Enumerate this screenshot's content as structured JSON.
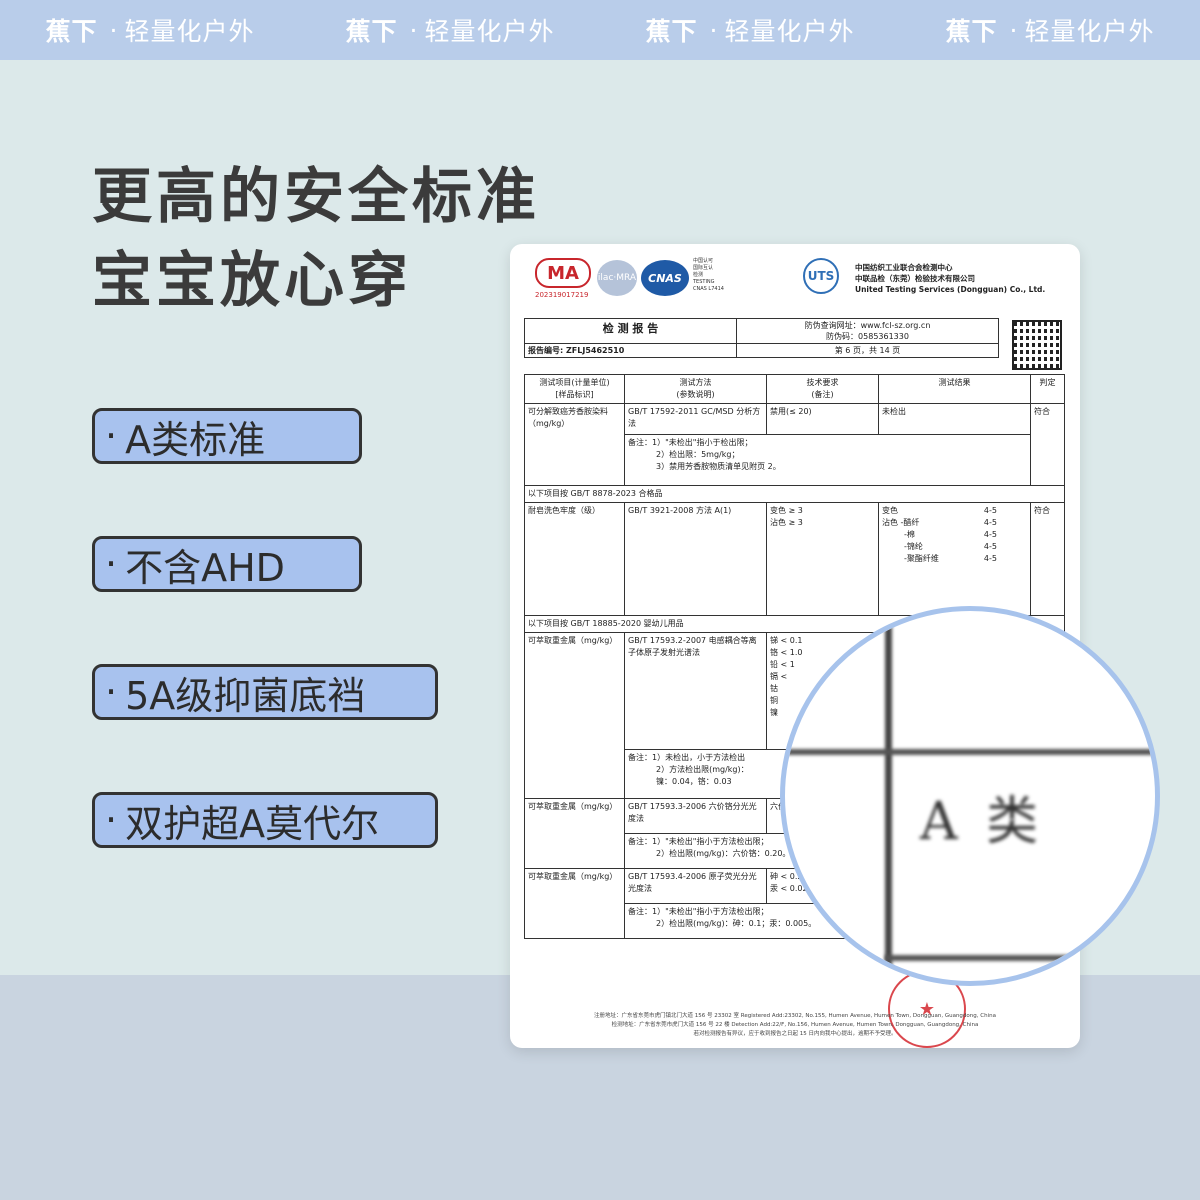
{
  "brand": {
    "name": "蕉下",
    "sep": "·",
    "tagline": "轻量化户外"
  },
  "headline": {
    "line1": "更高的安全标准",
    "line2": "宝宝放心穿"
  },
  "features": [
    {
      "dot": "·",
      "label": "A类标准"
    },
    {
      "dot": "·",
      "label": "不含AHD"
    },
    {
      "dot": "·",
      "label": "5A级抑菌底裆"
    },
    {
      "dot": "·",
      "label": "双护超A莫代尔"
    }
  ],
  "report": {
    "ma_label": "MA",
    "ma_number": "202319017219",
    "ilac_label": "ilac·MRA",
    "cnas_label": "CNAS",
    "cnas_text": [
      "中国认可",
      "国际互认",
      "检测",
      "TESTING",
      "CNAS L7414"
    ],
    "uts_label": "UTS",
    "org": [
      "中国纺织工业联合会检测中心",
      "中联品检（东莞）检验技术有限公司",
      "United Testing Services (Dongguan) Co., Ltd."
    ],
    "title": "检 测 报 告",
    "report_no_label": "报告编号:",
    "report_no": "ZFLJ5462510",
    "query_site_label": "防伪查询网址：",
    "query_site": "www.fcl-sz.org.cn",
    "anti_fake_label": "防伪码：",
    "anti_fake": "0585361330",
    "page": "第 6 页，共 14 页",
    "headers": {
      "item": "测试项目(计量单位)",
      "item_sub": "[样品标识]",
      "method": "测试方法",
      "method_sub": "(参数说明)",
      "req": "技术要求",
      "req_sub": "(备注)",
      "result": "测试结果",
      "verdict": "判定"
    },
    "row1": {
      "item": "可分解致癌芳香胺染料（mg/kg）",
      "method": "GB/T 17592-2011 GC/MSD 分析方法",
      "req": "禁用(≤ 20)",
      "result": "未检出",
      "verdict": "符合",
      "note1": "备注：1）\"未检出\"指小于检出限；",
      "note2": "2）检出限：5mg/kg；",
      "note3": "3）禁用芳香胺物质清单见附页 2。"
    },
    "section1": "以下项目按 GB/T 8878-2023 合格品",
    "row2": {
      "item": "耐皂洗色牢度（级）",
      "method": "GB/T 3921-2008 方法 A(1)",
      "req1": "变色 ≥ 3",
      "req2": "沾色 ≥ 3",
      "verdict": "符合",
      "results": [
        {
          "k": "变色",
          "v": "4-5"
        },
        {
          "k": "沾色 -醋纤",
          "v": "4-5"
        },
        {
          "k": "-棉",
          "v": "4-5"
        },
        {
          "k": "-锦纶",
          "v": "4-5"
        },
        {
          "k": "-聚酯纤维",
          "v": "4-5"
        }
      ]
    },
    "section2": "以下项目按 GB/T 18885-2020 婴幼儿用品",
    "row3": {
      "item": "可萃取重金属（mg/kg）",
      "method": "GB/T 17593.2-2007 电感耦合等离子体原子发射光谱法",
      "reqs": [
        "锑 < 0.1",
        "铬 < 1.0",
        "铅 < 1",
        "镉 <",
        "钴",
        "铜",
        "镍"
      ],
      "note1": "备注：1）未检出，小于方法检出",
      "note2": "2）方法检出限(mg/kg)：",
      "note3": "镍：0.04，铬：0.03"
    },
    "row4": {
      "item": "可萃取重金属（mg/kg）",
      "method": "GB/T 17593.3-2006 六价铬分光光度法",
      "req": "六价",
      "note1": "备注：1）\"未检出\"指小于方法检出限；",
      "note2": "2）检出限(mg/kg)：六价铬：0.20。"
    },
    "row5": {
      "item": "可萃取重金属（mg/kg）",
      "method": "GB/T 17593.4-2006 原子荧光分光光度法",
      "req1": "砷 < 0.2",
      "req2": "汞 < 0.02",
      "note1": "备注：1）\"未检出\"指小于方法检出限；",
      "note2": "2）检出限(mg/kg)：砷：0.1；汞：0.005。"
    },
    "footer1": "注册地址：广东省东莞市虎门镇北门大道 156 号 23302 室 Registered Add:23302, No.155, Humen Avenue, Humen Town, Dongguan, Guangdong, China",
    "footer2": "检测地址：广东省东莞市虎门大道 156 号 22 楼 Detection Add:22/F, No.156, Humen Avenue, Humen Town, Dongguan, Guangdong, China",
    "footer3": "若对检测报告有异议，应于收到报告之日起 15 日内向我中心提出，逾期不予受理。",
    "stamp": "★"
  },
  "magnifier": {
    "text": "A 类"
  }
}
